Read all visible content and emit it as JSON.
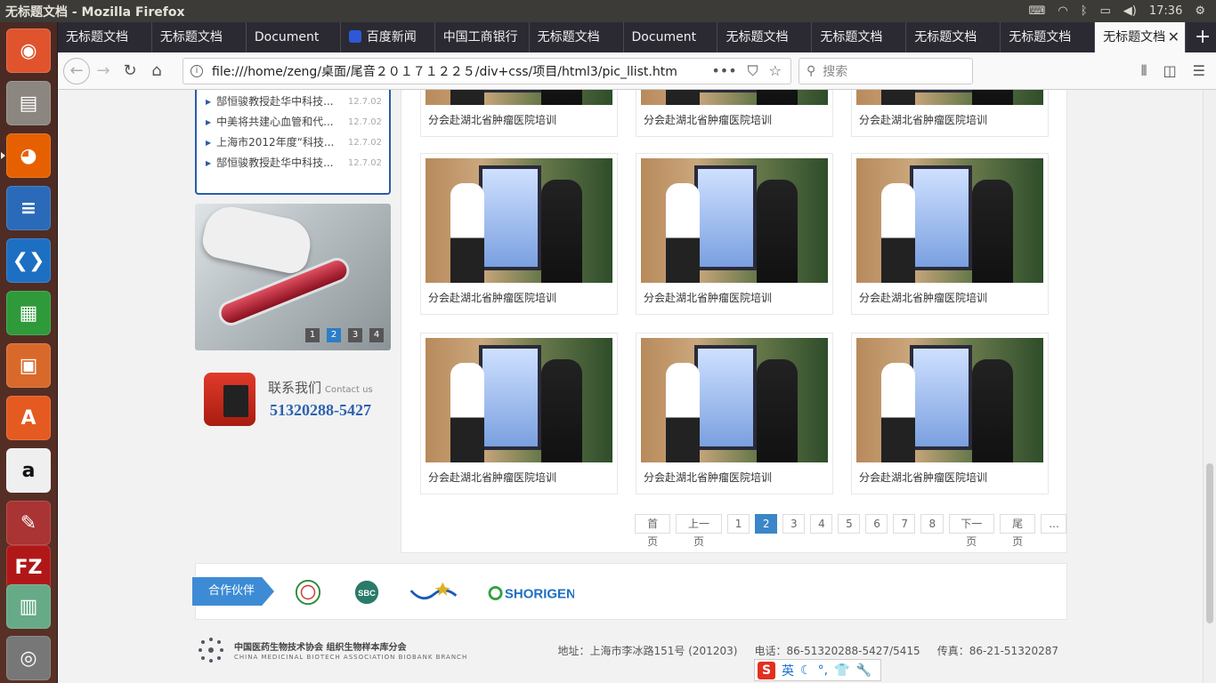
{
  "window_title": "无标题文档 - Mozilla Firefox",
  "clock": "17:36",
  "tabs": [
    {
      "label": "无标题文档"
    },
    {
      "label": "无标题文档"
    },
    {
      "label": "Document"
    },
    {
      "label": "百度新闻"
    },
    {
      "label": "中国工商银行"
    },
    {
      "label": "无标题文档"
    },
    {
      "label": "Document"
    },
    {
      "label": "无标题文档"
    },
    {
      "label": "无标题文档"
    },
    {
      "label": "无标题文档"
    },
    {
      "label": "无标题文档"
    },
    {
      "label": "无标题文档"
    }
  ],
  "url": "file:///home/zeng/桌面/尾音２０１７１２２５/div+css/项目/html3/pic_llist.htm",
  "search_placeholder": "搜索",
  "news": [
    {
      "title": "郜恒骏教授赴华中科技...",
      "date": "12.7.02"
    },
    {
      "title": "中美将共建心血管和代...",
      "date": "12.7.02"
    },
    {
      "title": "上海市2012年度“科技...",
      "date": "12.7.02"
    },
    {
      "title": "郜恒骏教授赴华中科技...",
      "date": "12.7.02"
    }
  ],
  "slider_dots": [
    "1",
    "2",
    "3",
    "4"
  ],
  "slider_active": "2",
  "contact": {
    "label": "联系我们",
    "label_en": "Contact us",
    "phone": "51320288-5427"
  },
  "photo_caption": "分会赴湖北省肿瘤医院培训",
  "photos_top_captions": [
    "分会赴湖北省肿瘤医院培训",
    "分会赴湖北省肿瘤医院培训",
    "分会赴湖北省肿瘤医院培训"
  ],
  "photos": [
    {
      "caption": "分会赴湖北省肿瘤医院培训"
    },
    {
      "caption": "分会赴湖北省肿瘤医院培训"
    },
    {
      "caption": "分会赴湖北省肿瘤医院培训"
    },
    {
      "caption": "分会赴湖北省肿瘤医院培训"
    },
    {
      "caption": "分会赴湖北省肿瘤医院培训"
    },
    {
      "caption": "分会赴湖北省肿瘤医院培训"
    }
  ],
  "pager": {
    "first": "首页",
    "prev": "上一页",
    "pages": [
      "1",
      "2",
      "3",
      "4",
      "5",
      "6",
      "7",
      "8"
    ],
    "current": "2",
    "next": "下一页",
    "last": "尾页",
    "more": "..."
  },
  "partners": {
    "label": "合作伙伴",
    "logos": [
      "sbc-text",
      "shorigen-text"
    ],
    "sbc": "SBC",
    "shorigen": "SHORIGEN"
  },
  "footer": {
    "org_cn": "中国医药生物技术协会 组织生物样本库分会",
    "org_en": "CHINA MEDICINAL BIOTECH ASSOCIATION BIOBANK BRANCH",
    "address": "地址：上海市李冰路151号 (201203)",
    "phone": "电话：86-51320288-5427/5415",
    "fax": "传真：86-21-51320287"
  },
  "ime": {
    "mode": "英"
  },
  "colors": {
    "accent": "#3a86c8",
    "brand_blue": "#2b5ca8",
    "launcher": "#4a2a24"
  }
}
